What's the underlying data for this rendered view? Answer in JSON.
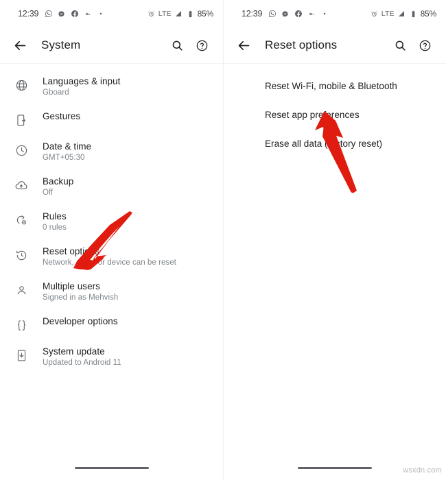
{
  "watermark": "wsxdn.com",
  "accent_red": "#e01b10",
  "colors": {
    "title_text": "#202124",
    "subtitle_text": "#80868b",
    "icon": "#5f6368",
    "background": "#ffffff",
    "divider": "#f1f3f4"
  },
  "left_screen": {
    "status_bar": {
      "time": "12:39",
      "icons": [
        "whatsapp-icon",
        "messenger-icon",
        "facebook-icon",
        "app-icon",
        "dot-icon"
      ],
      "alarm_icon": "alarm-icon",
      "network": "LTE",
      "signal_icon": "signal-icon",
      "battery_icon": "battery-icon",
      "battery": "85%"
    },
    "app_bar": {
      "back_icon": "back-arrow-icon",
      "title": "System",
      "search_icon": "search-icon",
      "help_icon": "help-icon"
    },
    "items": [
      {
        "icon": "globe-icon",
        "title": "Languages & input",
        "subtitle": "Gboard"
      },
      {
        "icon": "gestures-icon",
        "title": "Gestures",
        "subtitle": ""
      },
      {
        "icon": "clock-icon",
        "title": "Date & time",
        "subtitle": "GMT+05:30"
      },
      {
        "icon": "cloud-backup-icon",
        "title": "Backup",
        "subtitle": "Off"
      },
      {
        "icon": "rules-icon",
        "title": "Rules",
        "subtitle": "0 rules"
      },
      {
        "icon": "reset-history-icon",
        "title": "Reset options",
        "subtitle": "Network, apps, or device can be reset"
      },
      {
        "icon": "person-icon",
        "title": "Multiple users",
        "subtitle": "Signed in as Mehvish"
      },
      {
        "icon": "braces-icon",
        "title": "Developer options",
        "subtitle": ""
      },
      {
        "icon": "system-update-icon",
        "title": "System update",
        "subtitle": "Updated to Android 11"
      }
    ]
  },
  "right_screen": {
    "status_bar": {
      "time": "12:39",
      "icons": [
        "whatsapp-icon",
        "messenger-icon",
        "facebook-icon",
        "app-icon",
        "dot-icon"
      ],
      "alarm_icon": "alarm-icon",
      "network": "LTE",
      "signal_icon": "signal-icon",
      "battery_icon": "battery-icon",
      "battery": "85%"
    },
    "app_bar": {
      "back_icon": "back-arrow-icon",
      "title": "Reset options",
      "search_icon": "search-icon",
      "help_icon": "help-icon"
    },
    "items": [
      {
        "title": "Reset Wi-Fi, mobile & Bluetooth"
      },
      {
        "title": "Reset app preferences"
      },
      {
        "title": "Erase all data (factory reset)"
      }
    ]
  },
  "annotations": [
    {
      "name": "arrow-pointing-to-reset-options",
      "color": "#e01b10"
    },
    {
      "name": "arrow-pointing-to-reset-app-preferences",
      "color": "#e01b10"
    }
  ]
}
